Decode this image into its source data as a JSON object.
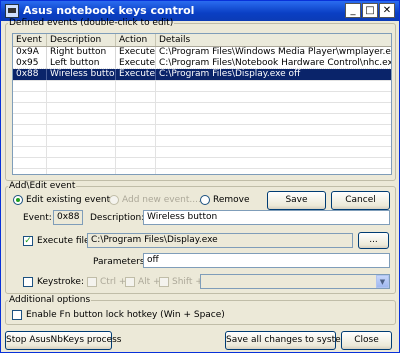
{
  "window": {
    "title": "Asus notebook keys control",
    "min_glyph": "_",
    "max_glyph": "□",
    "close_glyph": "✕"
  },
  "events": {
    "legend": "Defined events (double-click to edit)",
    "columns": [
      "Event",
      "Description",
      "Action",
      "Details"
    ],
    "rows": [
      {
        "event": "0x9A",
        "description": "Right button",
        "action": "Execute",
        "details": "C:\\Program Files\\Windows Media Player\\wmplayer.exe"
      },
      {
        "event": "0x95",
        "description": "Left button",
        "action": "Execute",
        "details": "C:\\Program Files\\Notebook Hardware Control\\nhc.exe"
      },
      {
        "event": "0x88",
        "description": "Wireless button",
        "action": "Execute",
        "details": "C:\\Program Files\\Display.exe off"
      }
    ],
    "selected_row": 2
  },
  "edit": {
    "legend": "Add\\Edit event",
    "mode_options": [
      "Edit existing event",
      "Add new event....",
      "Remove"
    ],
    "selected_mode": "Edit existing event",
    "save_label": "Save",
    "cancel_label": "Cancel",
    "event_label": "Event:",
    "event_value": "0x88",
    "description_label": "Description:",
    "description_value": "Wireless button",
    "execute_label": "Execute file",
    "execute_checked": true,
    "execute_path": "C:\\Program Files\\Display.exe",
    "browse_label": "...",
    "parameters_label": "Parameters:",
    "parameters_value": "off",
    "keystroke_label": "Keystroke:",
    "keystroke_checked": false,
    "ctrl_label": "Ctrl +",
    "alt_label": "Alt +",
    "shift_label": "Shift +",
    "key_value": ""
  },
  "options": {
    "legend": "Additional options",
    "fn_lock_label": "Enable Fn button lock hotkey (Win + Space)",
    "fn_lock_checked": false
  },
  "footer": {
    "stop_label": "Stop AsusNbKeys process",
    "save_all_label": "Save all changes to system",
    "close_label": "Close"
  }
}
